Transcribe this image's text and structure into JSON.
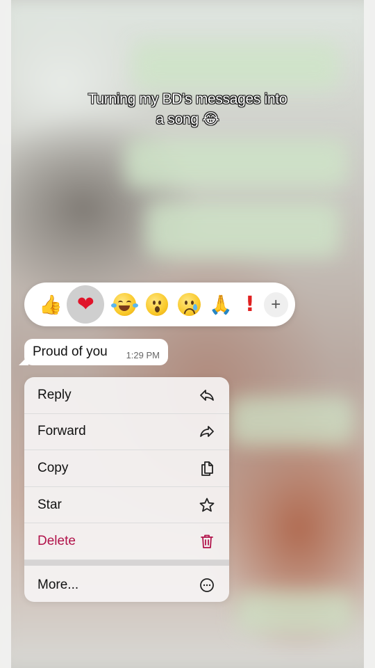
{
  "caption": {
    "line1": "Turning my BD’s messages into",
    "line2": "a song 😂"
  },
  "reactions": {
    "thumbs_up": "👍",
    "heart": "❤",
    "praying_hands": "🙏",
    "exclamation": "!",
    "add": "+"
  },
  "message": {
    "text": "Proud of you",
    "time": "1:29 PM"
  },
  "menu": {
    "reply": "Reply",
    "forward": "Forward",
    "copy": "Copy",
    "star": "Star",
    "delete": "Delete",
    "more": "More..."
  },
  "colors": {
    "danger": "#b1124a",
    "selected_reaction_bg": "#cfcfcf"
  }
}
